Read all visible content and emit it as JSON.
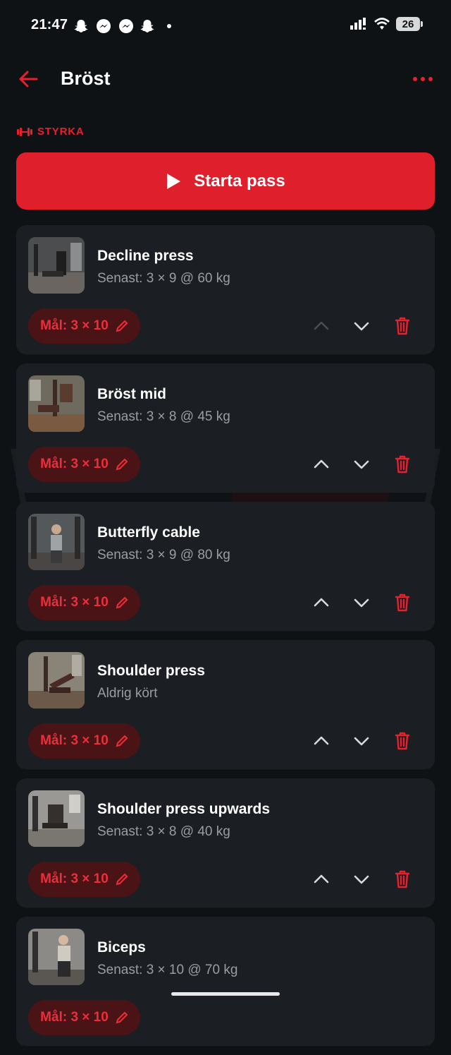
{
  "status_bar": {
    "time": "21:47",
    "battery": "26",
    "notification_icons": [
      "snapchat-icon",
      "messenger-icon",
      "messenger-icon",
      "snapchat-icon",
      "dot-icon"
    ]
  },
  "header": {
    "title": "Bröst"
  },
  "category": {
    "label": "STYRKA",
    "icon": "dumbbell-icon"
  },
  "start_button": {
    "label": "Starta pass"
  },
  "colors": {
    "accent": "#e01f2c",
    "background": "#0f1215",
    "card": "#1b1e22",
    "chip_bg": "#4a1417"
  },
  "exercises": [
    {
      "name": "Decline press",
      "last": "Senast: 3 × 9 @ 60 kg",
      "goal": "Mål: 3 × 10",
      "up_enabled": false
    },
    {
      "name": "Bröst mid",
      "last": "Senast: 3 × 8 @ 45 kg",
      "goal": "Mål: 3 × 10",
      "up_enabled": true
    },
    {
      "name": "Butterfly cable",
      "last": "Senast: 3 × 9 @ 80 kg",
      "goal": "Mål: 3 × 10",
      "up_enabled": true
    },
    {
      "name": "Shoulder press",
      "last": "Aldrig kört",
      "goal": "Mål: 3 × 10",
      "up_enabled": true
    },
    {
      "name": "Shoulder press upwards",
      "last": "Senast: 3 × 8 @ 40 kg",
      "goal": "Mål: 3 × 10",
      "up_enabled": true
    },
    {
      "name": "Biceps",
      "last": "Senast: 3 × 10 @ 70 kg",
      "goal": "Mål: 3 × 10",
      "up_enabled": true
    }
  ]
}
